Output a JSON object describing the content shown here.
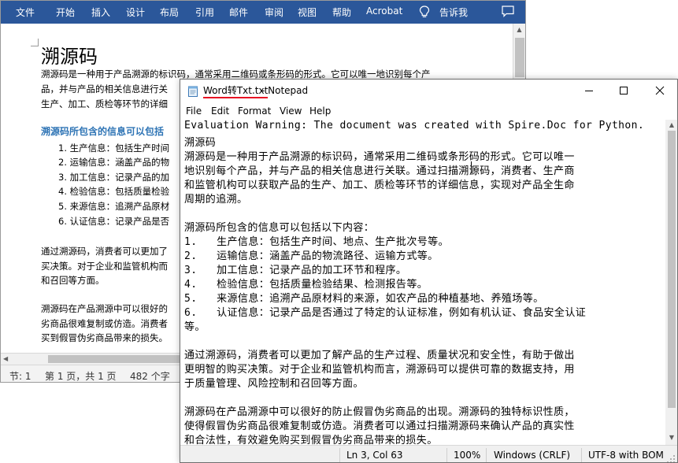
{
  "word": {
    "ribbon_tabs": [
      "文件",
      "开始",
      "插入",
      "设计",
      "布局",
      "引用",
      "邮件",
      "审阅",
      "视图",
      "帮助",
      "Acrobat",
      "告诉我"
    ],
    "document": {
      "title": "溯源码",
      "intro_lines": [
        "溯源码是一种用于产品溯源的标识码，通常采用二维码或条形码的形式。它可以唯一地识别每个产",
        "品，并与产品的相关信息进行关",
        "生产、加工、质检等环节的详细"
      ],
      "heading": "溯源码所包含的信息可以包括",
      "list_items": [
        "1.   生产信息：包括生产时间",
        "2.   运输信息：涵盖产品的物",
        "3.   加工信息：记录产品的加",
        "4.   检验信息：包括质量检验",
        "5.   来源信息：追溯产品原材",
        "6.   认证信息：记录产品是否"
      ],
      "para2_lines": [
        "通过溯源码，消费者可以更加了",
        "买决策。对于企业和监管机构而",
        "和召回等方面。"
      ],
      "para3_lines": [
        "溯源码在产品溯源中可以很好的",
        "劣商品很难复制或仿造。消费者",
        "买到假冒伪劣商品带来的损失。"
      ]
    },
    "status": {
      "section": "节: 1",
      "page": "第 1 页，共 1 页",
      "words": "482 个字"
    }
  },
  "notepad": {
    "title_file": "Word转Txt.txt",
    "title_rest": " - Notepad",
    "menu": [
      "File",
      "Edit",
      "Format",
      "View",
      "Help"
    ],
    "lines": [
      "Evaluation Warning: The document was created with Spire.Doc for Python.",
      "溯源码",
      "溯源码是一种用于产品溯源的标识码，通常采用二维码或条形码的形式。它可以唯一",
      "地识别每个产品，并与产品的相关信息进行关联。通过扫描溯源码，消费者、生产商",
      "和监管机构可以获取产品的生产、加工、质检等环节的详细信息，实现对产品全生命",
      "周期的追溯。",
      "",
      "溯源码所包含的信息可以包括以下内容：",
      "1.   生产信息：包括生产时间、地点、生产批次号等。",
      "2.   运输信息：涵盖产品的物流路径、运输方式等。",
      "3.   加工信息：记录产品的加工环节和程序。",
      "4.   检验信息：包括质量检验结果、检测报告等。",
      "5.   来源信息：追溯产品原材料的来源，如农产品的种植基地、养殖场等。",
      "6.   认证信息：记录产品是否通过了特定的认证标准，例如有机认证、食品安全认证",
      "等。",
      "",
      "通过溯源码，消费者可以更加了解产品的生产过程、质量状况和安全性，有助于做出",
      "更明智的购买决策。对于企业和监管机构而言，溯源码可以提供可靠的数据支持，用",
      "于质量管理、风险控制和召回等方面。",
      "",
      "溯源码在产品溯源中可以很好的防止假冒伪劣商品的出现。溯源码的独特标识性质，",
      "使得假冒伪劣商品很难复制或仿造。消费者可以通过扫描溯源码来确认产品的真实性",
      "和合法性，有效避免购买到假冒伪劣商品带来的损失。"
    ],
    "status": {
      "position": "Ln 3, Col 63",
      "zoom": "100%",
      "line_ending": "Windows (CRLF)",
      "encoding": "UTF-8 with BOM"
    }
  },
  "colors": {
    "ribbon": "#2b579a",
    "heading_blue": "#2e74b5",
    "title_underline": "#e81123"
  }
}
